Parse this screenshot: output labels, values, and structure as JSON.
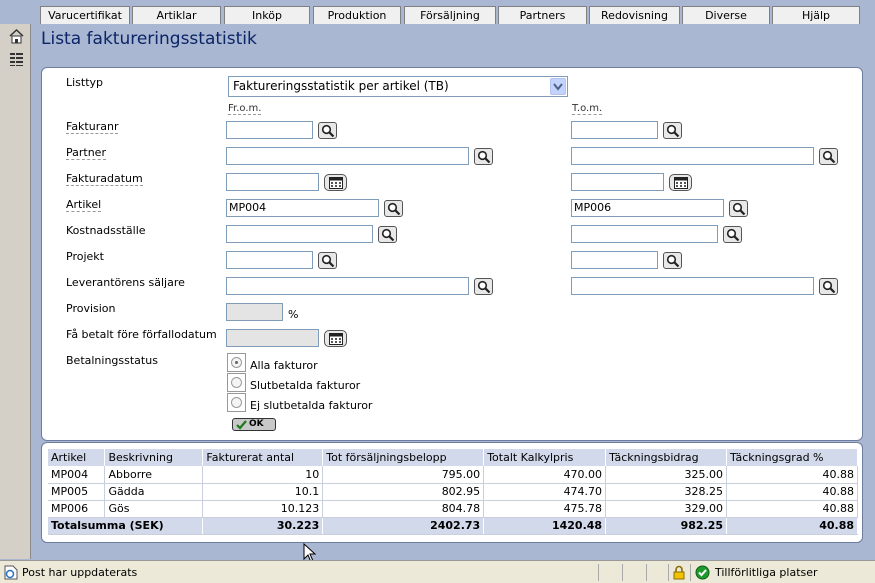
{
  "nav": {
    "tabs": [
      "Varucertifikat",
      "Artiklar",
      "Inköp",
      "Produktion",
      "Försäljning",
      "Partners",
      "Redovisning",
      "Diverse",
      "Hjälp"
    ]
  },
  "page": {
    "title": "Lista faktureringsstatistik"
  },
  "form": {
    "listtyp_label": "Listtyp",
    "listtyp_value": "Faktureringsstatistik per artikel (TB)",
    "from_header": "Fr.o.m.",
    "to_header": "T.o.m.",
    "fakturanr_label": "Fakturanr",
    "partner_label": "Partner",
    "fakturadatum_label": "Fakturadatum",
    "artikel_label": "Artikel",
    "artikel_from": "MP004",
    "artikel_to": "MP006",
    "kostnadsstalle_label": "Kostnadsställe",
    "projekt_label": "Projekt",
    "saljare_label": "Leverantörens säljare",
    "provision_label": "Provision",
    "provision_unit": "%",
    "betalt_label": "Få betalt före förfallodatum",
    "betalningsstatus_label": "Betalningsstatus",
    "radio_options": [
      "Alla fakturor",
      "Slutbetalda fakturor",
      "Ej slutbetalda fakturor"
    ],
    "selected_radio": "Alla fakturor",
    "ok_label": "OK"
  },
  "table": {
    "headers": [
      "Artikel",
      "Beskrivning",
      "Fakturerat antal",
      "Tot försäljningsbelopp",
      "Totalt Kalkylpris",
      "Täckningsbidrag",
      "Täckningsgrad %"
    ],
    "rows": [
      [
        "MP004",
        "Abborre",
        "10",
        "795.00",
        "470.00",
        "325.00",
        "40.88"
      ],
      [
        "MP005",
        "Gädda",
        "10.1",
        "802.95",
        "474.70",
        "328.25",
        "40.88"
      ],
      [
        "MP006",
        "Gös",
        "10.123",
        "804.78",
        "475.78",
        "329.00",
        "40.88"
      ]
    ],
    "total": [
      "Totalsumma (SEK)",
      "30.223",
      "2402.73",
      "1420.48",
      "982.25",
      "40.88"
    ]
  },
  "status": {
    "message": "Post har uppdaterats",
    "zone": "Tillförlitliga platser"
  },
  "colors": {
    "background": "#a9b7d2",
    "title": "#0a2466",
    "table_header": "#d2d9ea"
  },
  "icons": [
    "home-icon",
    "list-icon",
    "search-icon",
    "calendar-icon",
    "check-icon",
    "lock-icon",
    "ie-page-icon",
    "trusted-zone-icon",
    "mouse-cursor-icon",
    "dropdown-arrow-icon"
  ]
}
